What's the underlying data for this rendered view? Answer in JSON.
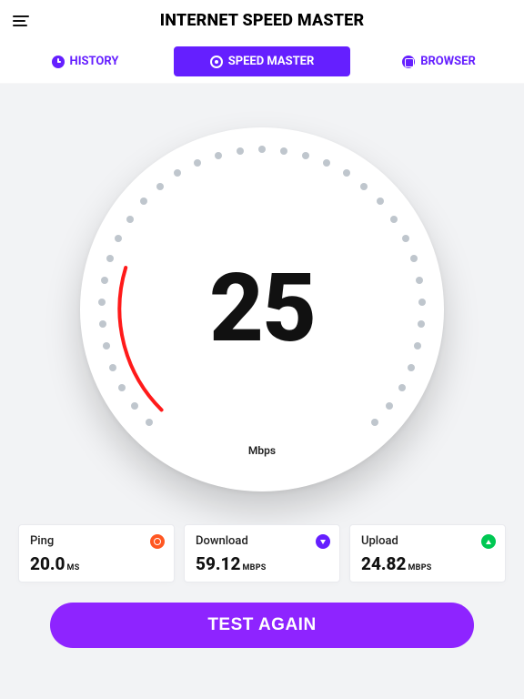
{
  "header": {
    "title": "INTERNET SPEED MASTER"
  },
  "tabs": {
    "history_label": "HISTORY",
    "speed_label": "SPEED MASTER",
    "browser_label": "BROWSER"
  },
  "gauge": {
    "reading": "25",
    "unit": "Mbps"
  },
  "cards": {
    "ping": {
      "label": "Ping",
      "value": "20.0",
      "unit": "MS"
    },
    "download": {
      "label": "Download",
      "value": "59.12",
      "unit": "MBPS"
    },
    "upload": {
      "label": "Upload",
      "value": "24.82",
      "unit": "MBPS"
    }
  },
  "cta": {
    "label": "TEST AGAIN"
  }
}
